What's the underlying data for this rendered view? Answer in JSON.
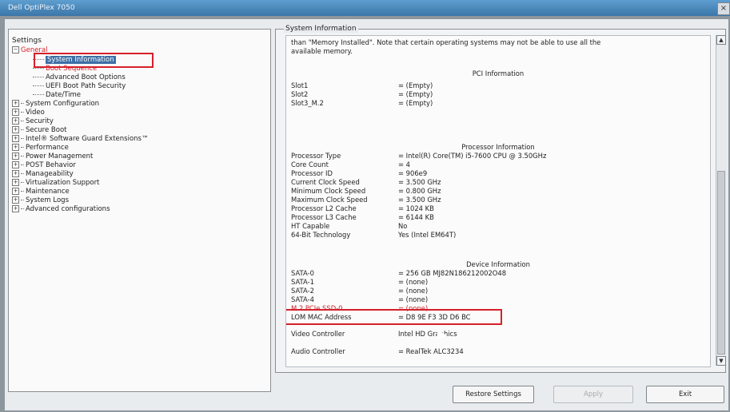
{
  "window": {
    "title": "Dell OptiPlex 7050",
    "close_glyph": "×"
  },
  "tree": {
    "root_label": "Settings",
    "items": [
      {
        "label": "General",
        "expanded": true,
        "children": [
          {
            "label": "System Information"
          },
          {
            "label": "Boot Sequence"
          },
          {
            "label": "Advanced Boot Options"
          },
          {
            "label": "UEFI Boot Path Security"
          },
          {
            "label": "Date/Time"
          }
        ]
      },
      {
        "label": "System Configuration"
      },
      {
        "label": "Video"
      },
      {
        "label": "Security"
      },
      {
        "label": "Secure Boot"
      },
      {
        "label": "Intel® Software Guard Extensions™"
      },
      {
        "label": "Performance"
      },
      {
        "label": "Power Management"
      },
      {
        "label": "POST Behavior"
      },
      {
        "label": "Manageability"
      },
      {
        "label": "Virtualization Support"
      },
      {
        "label": "Maintenance"
      },
      {
        "label": "System Logs"
      },
      {
        "label": "Advanced configurations"
      }
    ]
  },
  "panel": {
    "title": "System Information",
    "note_line1": "than \"Memory Installed\". Note that certain operating systems may not be able to use all the",
    "note_line2": "available memory.",
    "pci_heading": "PCI Information",
    "pci": [
      {
        "k": "Slot1",
        "v": "= (Empty)"
      },
      {
        "k": "Slot2",
        "v": "= (Empty)"
      },
      {
        "k": "Slot3_M.2",
        "v": "= (Empty)"
      }
    ],
    "processor_heading": "Processor Information",
    "processor": [
      {
        "k": "Processor Type",
        "v": "= Intel(R) Core(TM) i5-7600 CPU @ 3.50GHz"
      },
      {
        "k": "Core Count",
        "v": "= 4"
      },
      {
        "k": "Processor ID",
        "v": "= 906e9"
      },
      {
        "k": "Current Clock Speed",
        "v": "= 3.500 GHz"
      },
      {
        "k": "Minimum Clock Speed",
        "v": "= 0.800 GHz"
      },
      {
        "k": "Maximum Clock Speed",
        "v": "= 3.500 GHz"
      },
      {
        "k": "Processor L2 Cache",
        "v": "= 1024 KB"
      },
      {
        "k": "Processor L3 Cache",
        "v": "= 6144 KB"
      },
      {
        "k": "HT Capable",
        "v": "No"
      },
      {
        "k": "64-Bit Technology",
        "v": "Yes (Intel EM64T)"
      }
    ],
    "device_heading": "Device Information",
    "device": [
      {
        "k": "SATA-0",
        "v": "= 256 GB MJ82N186212002O48"
      },
      {
        "k": "SATA-1",
        "v": "= (none)"
      },
      {
        "k": "SATA-2",
        "v": "= (none)"
      },
      {
        "k": "SATA-4",
        "v": "= (none)"
      },
      {
        "k": "M.2 PCIe SSD-0",
        "v": "= (none)"
      },
      {
        "k": "LOM MAC Address",
        "v": "= D8 9E F3 3D D6 BC"
      },
      {
        "k": "Video Controller",
        "v": "Intel HD Graphics"
      },
      {
        "k": "Audio Controller",
        "v": "= RealTek ALC3234"
      }
    ]
  },
  "buttons": {
    "restore": "Restore Settings",
    "apply": "Apply",
    "exit": "Exit"
  },
  "colors": {
    "title_bar": "#4a88bd",
    "highlight": "#d6202a",
    "selection": "#3d6fa6"
  }
}
